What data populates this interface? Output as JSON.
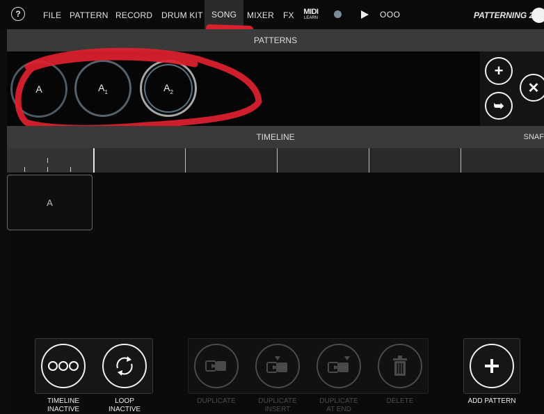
{
  "nav": {
    "help": "?",
    "menu": [
      "FILE",
      "PATTERN",
      "RECORD",
      "DRUM KIT",
      "SONG",
      "MIXER",
      "FX"
    ],
    "active": "SONG",
    "midi_label": "MIDI",
    "midi_sub": "LEARN",
    "tempo_indicator": "OOO",
    "project_title": "PATTERNING 2"
  },
  "patterns": {
    "header": "PATTERNS",
    "items": [
      {
        "label": "A"
      },
      {
        "label": "A",
        "sub": "1"
      },
      {
        "label": "A",
        "sub": "2"
      }
    ],
    "add_icon": "+",
    "continue_icon": "➥",
    "close_icon": "✕"
  },
  "timeline": {
    "header": "TIMELINE",
    "snap": "SNAF",
    "clip": "A"
  },
  "controls": {
    "timeline_inactive": [
      "TIMELINE",
      "INACTIVE"
    ],
    "loop_inactive": [
      "LOOP",
      "INACTIVE"
    ],
    "duplicate": [
      "DUPLICATE"
    ],
    "duplicate_insert": [
      "DUPLICATE",
      "INSERT"
    ],
    "duplicate_at_end": [
      "DUPLICATE",
      "AT END"
    ],
    "delete": [
      "DELETE"
    ],
    "add_pattern": [
      "ADD PATTERN"
    ],
    "ooo_icon": "OOO"
  },
  "colors": {
    "annotation_red": "#e0212f",
    "background": "#0d0d0d",
    "bar": "#3a3a3a"
  }
}
